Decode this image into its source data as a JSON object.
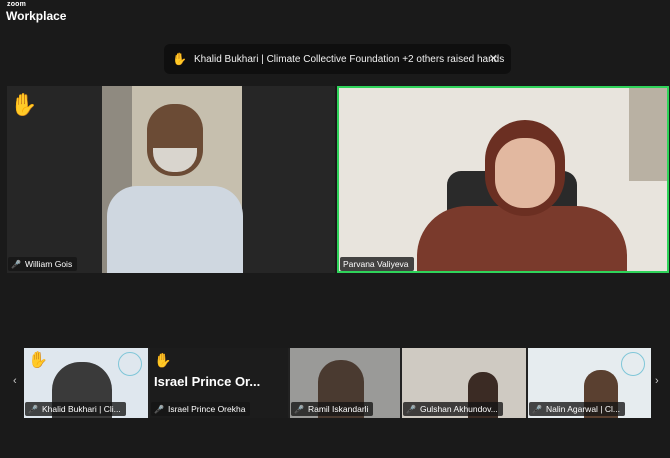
{
  "app": {
    "brand_small": "zoom",
    "brand_big": "Workplace"
  },
  "notification": {
    "hand_icon": "raised-hand-icon",
    "text": "Khalid Bukhari | Climate Collective Foundation +2 others raised hands",
    "close": "✕"
  },
  "main_tiles": [
    {
      "name": "William Gois",
      "muted": true,
      "hand_raised": true
    },
    {
      "name": "Parvana Valiyeva",
      "muted": false,
      "active_speaker": true
    }
  ],
  "gallery": [
    {
      "name": "Khalid Bukhari | Cli...",
      "muted": true,
      "hand_raised": true
    },
    {
      "name": "Israel Prince Orekha",
      "display": "Israel  Prince  Or...",
      "muted": true,
      "hand_raised": true
    },
    {
      "name": "Ramil Iskandarli",
      "muted": true
    },
    {
      "name": "Gulshan Akhundov...",
      "muted": true
    },
    {
      "name": "Nalin Agarwal | Cl...",
      "muted": true
    }
  ],
  "colors": {
    "active_border": "#2fd35a",
    "mute": "#e0342b",
    "hand": "#f5c518"
  }
}
